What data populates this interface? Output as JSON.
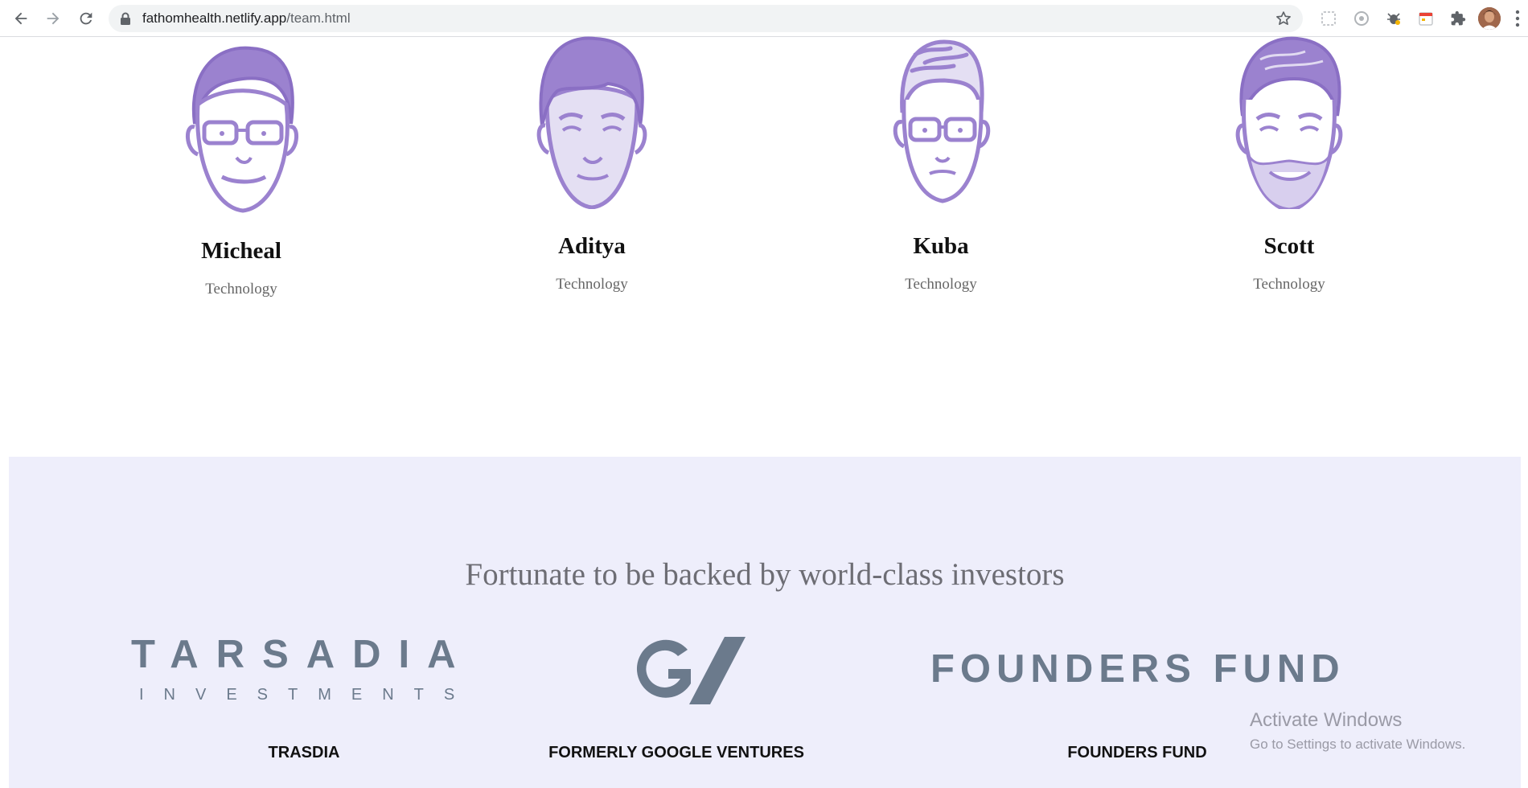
{
  "browser": {
    "url_domain": "fathomhealth.netlify.app",
    "url_path": "/team.html"
  },
  "team": {
    "members": [
      {
        "name": "Micheal",
        "role": "Technology",
        "icon": "person-glasses-icon"
      },
      {
        "name": "Aditya",
        "role": "Technology",
        "icon": "person-icon"
      },
      {
        "name": "Kuba",
        "role": "Technology",
        "icon": "person-glasses-icon"
      },
      {
        "name": "Scott",
        "role": "Technology",
        "icon": "person-beard-icon"
      }
    ]
  },
  "investors": {
    "heading": "Fortunate to be backed by world-class investors",
    "items": [
      {
        "logo_main": "TARSADIA",
        "logo_sub": "INVESTMENTS",
        "name": "TRASDIA"
      },
      {
        "logo_main": "GV",
        "name": "FORMERLY GOOGLE VENTURES"
      },
      {
        "logo_main": "FOUNDERS FUND",
        "name": "FOUNDERS FUND"
      }
    ]
  },
  "os_watermark": {
    "title": "Activate Windows",
    "subtitle": "Go to Settings to activate Windows."
  },
  "colors": {
    "face_purple": "#9b82cf",
    "investor_bg": "#eeeefb",
    "logo_slate": "#6b7a8c"
  }
}
